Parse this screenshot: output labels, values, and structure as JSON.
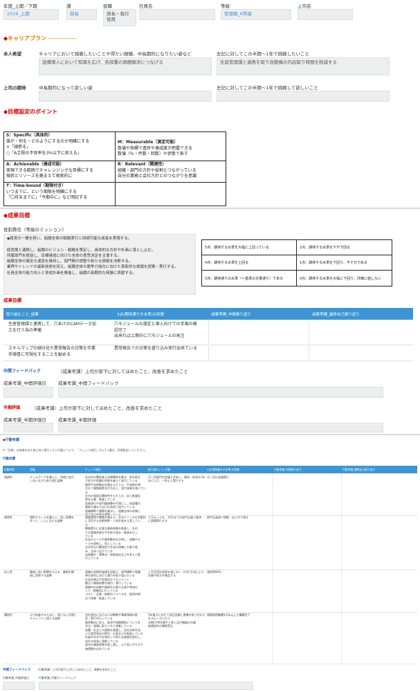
{
  "header": {
    "col_period": "年度_上期／下期",
    "col_section": "課",
    "col_role": "役職",
    "col_name": "社員名",
    "col_grade": "等級",
    "col_boss": "上司名",
    "period_value": "2026_上期",
    "section_value": "部長",
    "role_value": "部長・執行役員",
    "grade_value": "管理職_6等級"
  },
  "career": {
    "title": "キャリアプラン",
    "self_label": "本人希望",
    "self_q1": "キャリアにおいて挑戦したいことや得たい経験、中長期的になりたい姿など",
    "self_q2": "左記に対してこの半期〜1年で挑戦したいこと",
    "self_a1": "設備導入において知識を広げ、各部署の問題解決につなげる",
    "self_a2": "生産管理課と連携を取り自動機の内段取り時間を削減する",
    "boss_label": "上司の期待",
    "boss_q1": "中長期的になって欲しい姿",
    "boss_q2": "左記に対してこの半期〜1年で挑戦して欲しいこと"
  },
  "goal_points": {
    "title": "目標設定のポイント",
    "s_title": "S：Specific（具体的）",
    "s_body": "誰が・何を・どのようにするのか明確にする\n×「頑張る」\n○「A工程の不良率を3%以下に抑える」",
    "m_title": "M：Measurable（測定可能）",
    "m_body": "数値や指標で進捗や達成度が把握できる\n数値（%・件数・回数）や状態で表す",
    "a_title": "A：Achievable（達成可能）",
    "a_body": "実現できる範囲でチャレンジングな目標にする\n現状とリソースを踏まえて現実的に",
    "r_title": "R：Relevant（関連性）",
    "r_body": "組織・部門の方針や役割とつながっている\n自分の業務と会社方針とのつながりを意識",
    "t_title": "T：Time-bound（期限付き）",
    "t_body": "いつまでに、という期限を明確にする\n「〇月末までに」「今期中に」など明記する"
  },
  "results": {
    "title": "成果目標",
    "mission_label": "役割責任（等級のミッション）",
    "mission_text": "◆経営の一翼を担い、組織全体の戦略実行と持続可能な成長を実現する。\n\n経営層と連携し、組織のビジョン・戦略を策定し、具体的な方針や計画に落とし込む。\n所属部門を統括し、目標達成に向けた全体の意思決定を主導する。\n組織全体の健全な運営を維持し、部門間の調整や新たな挑戦を決断する。\n業界やトレンドの最新技術を捉え、組織全体の競争力強化に向けた革新的な挑戦を提案・実行する。\n社員全体の能力向上と育成計画を推進し、組織の長期的な発展に貢献する。",
    "scale": [
      [
        "5点：期待する水準を大幅に上回っている",
        "2点：期待する水準をやや下回る"
      ],
      [
        "4点：期待する水準を上回る",
        "1点：期待する水準を下回り、不十分である"
      ],
      [
        "3点：期待通りの水準（＝基準の文量通り）である",
        "0点：期待する水準を大幅に下回り、評価に値しない"
      ]
    ],
    "subtitle": "成果目標",
    "th1": "取り組むこと_成果",
    "th2": "3点(期待通りの水準)の状態",
    "th3": "成果考課_中間振り返り",
    "th4": "成果考課_最終自己振り返り",
    "row1_c1": "生産管理課と連携して、穴あけのCAMデータ加\n工を行う為の準備",
    "row1_c2": "穴モジュールの選定と導入向けての手順の確\n認完了\n出来れば上期中に穴モジュールの発注",
    "row2_c1": "スキルマップの細分化や異常報告の対策を作業\n手順書に可視化することを勧める",
    "row2_c2": "異常報告での対策を盛り込み実行出来ている",
    "mid_fb_label": "中間フィードバック",
    "mid_fb_note": "（成果考課）上司が部下に対してほめたこと、改善を求めたこと",
    "mid_date_label": "成果考課_中間評価日",
    "mid_fb_field_label": "成果考課_中間フィードバック",
    "half_label": "半期評価",
    "half_note": "（成果考課）上司が部下に対してほめたこと、改善を求めたこと",
    "half_date_label": "成果考課_半期評価日",
    "half_field_label": "成果考課_半期評価"
  },
  "behavior": {
    "title": "行動考課",
    "note": "※「目標」の成果を出す為に特に実行したい行動について、「チェック項目」から1つ選び、目標設定してください。",
    "subtitle": "行動目標",
    "th": [
      "行動特性",
      "定義",
      "チェック項目",
      "取り組むこと_行動",
      "3点(期待通りの水準)の状態",
      "行動考課_中間振り返り",
      "行動考課_最終自己振り返り"
    ],
    "rows": [
      {
        "c1": "協調性",
        "c2": "チームワークを重んじ、仲間と協力\nし合いながら取り組む姿勢",
        "c3": "社内外の関係者と信頼関係を築き、多社視点\nで担当や役職の垣根を越えて協力している\n業界や技術動向を踏まえたうえ、中長期の視\n点をで連携施策を打ち出し、協力体制を強いてい\nる\n社内の強固な関係性をもたらせ、自ら推進役\n割を企業・推進している\n役割遂行や部門間調整を円滑にし、他部署の\n業務も踏まえ自己の成長で協力している\n組織横断で課題を解決し、組織全体の成果に\n向け協力体制を構築している",
        "c4": "月一回部門内会議と共有し、課長・係長を1年\nほど上げ、一年以上実行する",
        "c5": "月一回の会議実行"
      },
      {
        "c1": "規律性",
        "c2": "規則やルールを重んじ、良い習慣を\n作って、ことに当たる姿勢",
        "c3": "事業環境や戦略を踏まえ、社内リソースを効果的\nに活用する長期視野・人材計画を立案してい\nる\n戦略実行に必要な業務改善を推進し、社内\nでの意識改革を手を取り組み・推進を行っ\nている\n社会のルールや業界動向を注視し、組織やル\nールを随時し、導入している\n全社的な行動指針や文化の改善にも取り組\nみ、全体へ広げている\n自組織を・標準化・体制強化などを考えて実\n行している",
        "c4": "六月ルールを、10月までの部門全員で経済\nに設備実行する",
        "c5": "部門全員達で理解、自ら守り得る"
      },
      {
        "c1": "向上性",
        "c2": "最新に良い影響を与える、業務を積\n極に改革する姿勢",
        "c3": "組織の長期的価値を見据え、部門横断で組織\n単位体的に向けた実行を取り組んでいる\n社会的視点や定量的なマネジメント\n観点で業務改善を検討・実行している\n組織内の改善や業務を仕事で企画や育成の\nして、戦略的に行っている\nコスト・品質・納期のバランスを、経営的視\n点で改善・推進している",
        "c4": "入手活用計画表を達に3人・4.0行方向により\n計算手続きを確定する",
        "c5": "達成率80%"
      },
      {
        "c1": "積極性",
        "c2": "より前進するために、常にない分野に\nチャレンジし続ける姿勢",
        "c3": "会社視点に伝行る人材戦略や事業領域の創\n造・実行を行っている\n業界動向に捉え、経営や組織運営について本\n学び、現場に取り入れて改善している\n部署・社会との連携を意識し、自社技術を用\nいた経営強化の提言・企画などを推進している\n社員がみの力を伸ばして新たな価値を創出し、\n自社の成長に貢献している\n部内の業務改善を推し通し、より良いやり方や\n価値観を広めている",
        "c4": "5年後大に向けて部品金額と連携を取り合わせ\nをスムーズに行う\n次期CAM作業手と導入及び機器の作業\n新規案件の積極受注",
        "c5": "規格取得機種を2本以上で構築完了"
      }
    ],
    "mid_fb_label": "中間フィードバック",
    "mid_fb_note": "（行動考課）上司が部下に対してほめたこと、改善を求めたこと",
    "mid_date_label": "行動考課_中間評価日",
    "mid_fb_field_label": "行動考課_中間フィードバック"
  }
}
